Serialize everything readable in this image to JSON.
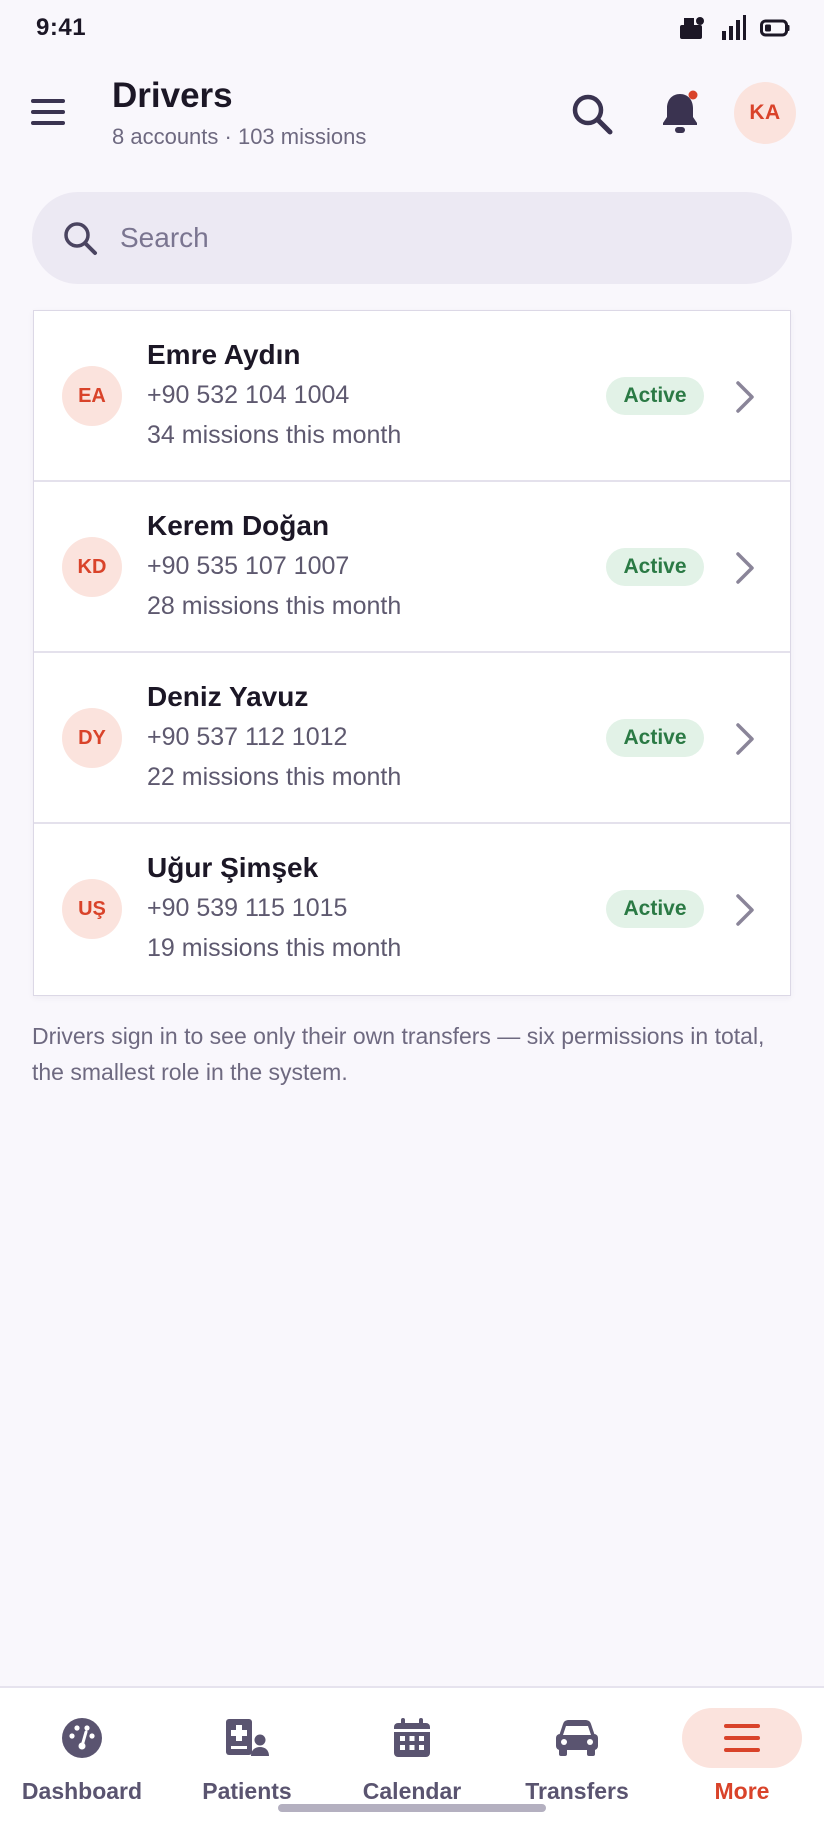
{
  "status_bar": {
    "time": "9:41"
  },
  "header": {
    "title": "Drivers",
    "subtitle": "8 accounts · 103 missions",
    "avatar_initials": "KA"
  },
  "search": {
    "placeholder": "Search",
    "value": ""
  },
  "drivers": [
    {
      "initials": "EA",
      "name": "Emre Aydın",
      "phone": "+90 532 104 1004",
      "missions": "34 missions this month",
      "status": "Active"
    },
    {
      "initials": "KD",
      "name": "Kerem Doğan",
      "phone": "+90 535 107 1007",
      "missions": "28 missions this month",
      "status": "Active"
    },
    {
      "initials": "DY",
      "name": "Deniz Yavuz",
      "phone": "+90 537 112 1012",
      "missions": "22 missions this month",
      "status": "Active"
    },
    {
      "initials": "UŞ",
      "name": "Uğur Şimşek",
      "phone": "+90 539 115 1015",
      "missions": "19 missions this month",
      "status": "Active"
    }
  ],
  "footnote": "Drivers sign in to see only their own transfers — six permissions in total, the smallest role in the system.",
  "nav": [
    {
      "label": "Dashboard",
      "icon": "dashboard-icon"
    },
    {
      "label": "Patients",
      "icon": "patients-icon"
    },
    {
      "label": "Calendar",
      "icon": "calendar-icon"
    },
    {
      "label": "Transfers",
      "icon": "car-icon"
    },
    {
      "label": "More",
      "icon": "menu-icon",
      "active": true
    }
  ],
  "colors": {
    "accent": "#d9432a",
    "accent_soft": "#fbe3dd",
    "status_active_bg": "#e2f2e7",
    "status_active_text": "#2b7a45",
    "background": "#f9f7fc"
  }
}
